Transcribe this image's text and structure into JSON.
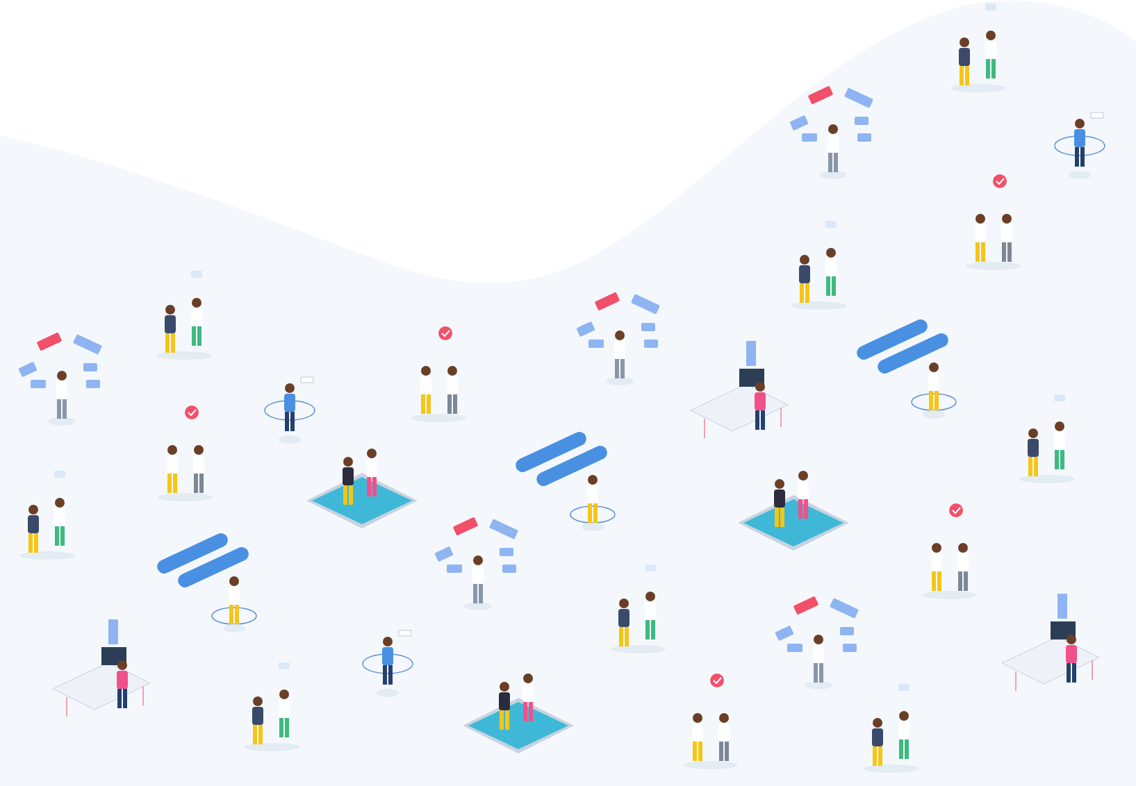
{
  "illustration": {
    "scenes": [
      {
        "kind": "pair"
      },
      {
        "kind": "pair"
      },
      {
        "kind": "pair"
      },
      {
        "kind": "pair"
      },
      {
        "kind": "pair"
      },
      {
        "kind": "pair"
      },
      {
        "kind": "pair"
      },
      {
        "kind": "pair"
      },
      {
        "kind": "topics"
      },
      {
        "kind": "topics"
      },
      {
        "kind": "topics"
      },
      {
        "kind": "topics"
      },
      {
        "kind": "topics"
      },
      {
        "kind": "walker"
      },
      {
        "kind": "walker"
      },
      {
        "kind": "walker"
      },
      {
        "kind": "handshake"
      },
      {
        "kind": "handshake"
      },
      {
        "kind": "handshake"
      },
      {
        "kind": "handshake"
      },
      {
        "kind": "handshake"
      },
      {
        "kind": "tablet"
      },
      {
        "kind": "tablet"
      },
      {
        "kind": "tablet"
      },
      {
        "kind": "chat"
      },
      {
        "kind": "chat"
      },
      {
        "kind": "chat"
      },
      {
        "kind": "desk"
      },
      {
        "kind": "desk"
      },
      {
        "kind": "desk"
      }
    ]
  }
}
